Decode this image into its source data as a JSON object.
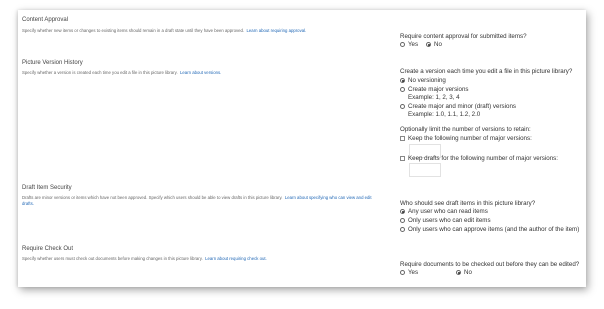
{
  "content_approval": {
    "title": "Content Approval",
    "description": "Specify whether new items or changes to existing items should remain in a draft state until they have been approved.",
    "link": "Learn about requiring approval.",
    "question": "Require content approval for submitted items?",
    "options": [
      "Yes",
      "No"
    ],
    "selected": "No"
  },
  "version_history": {
    "title": "Picture Version History",
    "description": "Specify whether a version is created each time you edit a file in this picture library.",
    "link": "Learn about versions.",
    "question": "Create a version each time you edit a file in this picture library?",
    "options": [
      {
        "label": "No versioning",
        "example": ""
      },
      {
        "label": "Create major versions",
        "example": "Example: 1, 2, 3, 4"
      },
      {
        "label": "Create major and minor (draft) versions",
        "example": "Example: 1.0, 1.1, 1.2, 2.0"
      }
    ],
    "selected": "No versioning",
    "limit_label": "Optionally limit the number of versions to retain:",
    "keep_major_label": "Keep the following number of major versions:",
    "keep_drafts_label": "Keep drafts for the following number of major versions:"
  },
  "draft_security": {
    "title": "Draft Item Security",
    "description": "Drafts are minor versions or items which have not been approved. Specify which users should be able to view drafts in this picture library.",
    "link": "Learn about specifying who can view and edit drafts.",
    "question": "Who should see draft items in this picture library?",
    "options": [
      "Any user who can read items",
      "Only users who can edit items",
      "Only users who can approve items (and the author of the item)"
    ],
    "selected": "Any user who can read items"
  },
  "check_out": {
    "title": "Require Check Out",
    "description": "Specify whether users must check out documents before making changes in this picture library.",
    "link": "Learn about requiring check out.",
    "question": "Require documents to be checked out before they can be edited?",
    "options": [
      "Yes",
      "No"
    ],
    "selected": "No"
  }
}
